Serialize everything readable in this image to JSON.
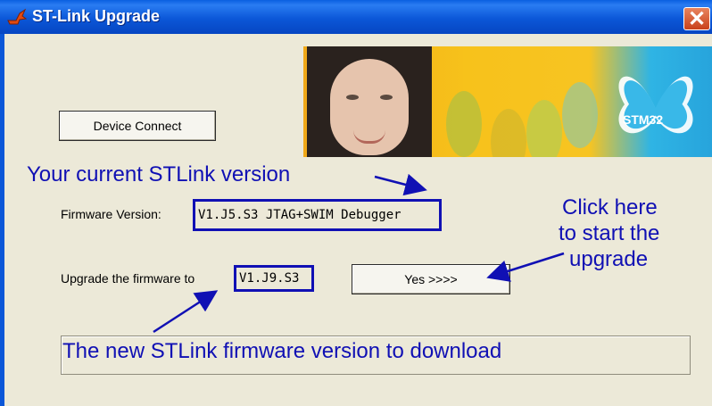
{
  "window": {
    "title": "ST-Link Upgrade",
    "close_glyph": "✕"
  },
  "banner": {
    "logo_text": "STM32"
  },
  "buttons": {
    "device_connect": "Device Connect",
    "yes": "Yes >>>>"
  },
  "firmware": {
    "version_label": "Firmware Version:",
    "version_value": "V1.J5.S3 JTAG+SWIM Debugger",
    "upgrade_label": "Upgrade the firmware to",
    "upgrade_value": "V1.J9.S3"
  },
  "annotations": {
    "current_version": "Your current STLink version",
    "click_here_line1": "Click here",
    "click_here_line2": "to start the",
    "click_here_line3": "upgrade",
    "new_version": "The new STLink firmware version to download"
  },
  "colors": {
    "annotation": "#1010b4",
    "titlebar": "#0b57d8",
    "face": "#ece9d8"
  }
}
